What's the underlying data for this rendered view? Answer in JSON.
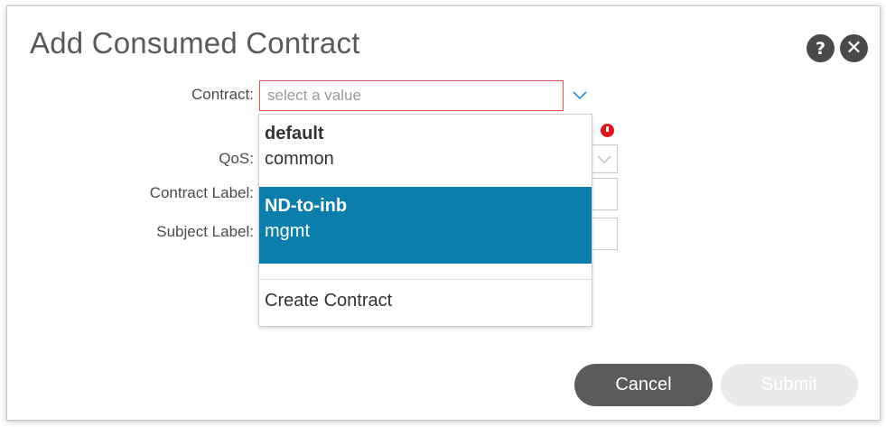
{
  "dialog": {
    "title": "Add Consumed Contract",
    "help_icon": "question-icon",
    "close_icon": "close-icon"
  },
  "form": {
    "contract_label": "Contract:",
    "contract_placeholder": "select a value",
    "qos_label": "QoS:",
    "contract_label_label": "Contract Label:",
    "subject_label_label": "Subject Label:"
  },
  "dropdown": {
    "items": [
      {
        "name": "default",
        "tenant": "common",
        "selected": false
      },
      {
        "name": "ND-to-inb",
        "tenant": "mgmt",
        "selected": true
      }
    ],
    "create_label": "Create Contract"
  },
  "buttons": {
    "cancel": "Cancel",
    "submit": "Submit"
  },
  "colors": {
    "selected_bg": "#0c7eab",
    "error": "#e0141e",
    "invalid_border": "#d9534f"
  }
}
